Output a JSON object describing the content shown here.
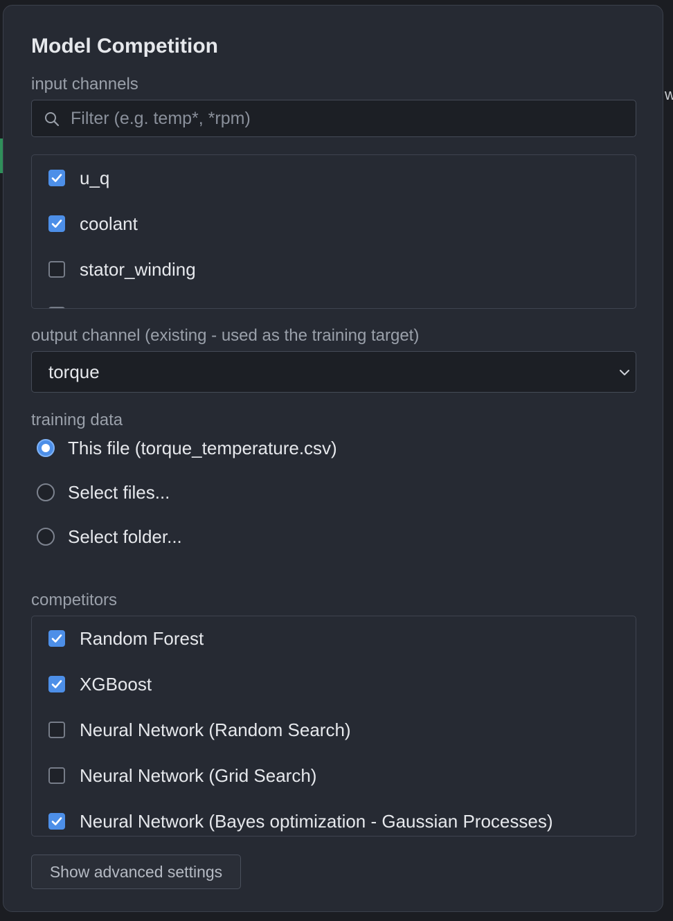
{
  "dialog": {
    "title": "Model Competition"
  },
  "input_channels": {
    "label": "input channels",
    "filter_placeholder": "Filter (e.g. temp*, *rpm)",
    "filter_value": "",
    "items": [
      {
        "label": "u_q",
        "checked": true
      },
      {
        "label": "coolant",
        "checked": true
      },
      {
        "label": "stator_winding",
        "checked": false
      },
      {
        "label": "",
        "checked": false
      }
    ]
  },
  "output_channel": {
    "label": "output channel (existing - used as the training target)",
    "selected": "torque"
  },
  "training_data": {
    "label": "training data",
    "options": [
      {
        "label": "This file (torque_temperature.csv)",
        "selected": true
      },
      {
        "label": "Select files...",
        "selected": false
      },
      {
        "label": "Select folder...",
        "selected": false
      }
    ]
  },
  "competitors": {
    "label": "competitors",
    "items": [
      {
        "label": "Random Forest",
        "checked": true
      },
      {
        "label": "XGBoost",
        "checked": true
      },
      {
        "label": "Neural Network (Random Search)",
        "checked": false
      },
      {
        "label": "Neural Network (Grid Search)",
        "checked": false
      },
      {
        "label": "Neural Network (Bayes optimization - Gaussian Processes)",
        "checked": true
      }
    ]
  },
  "advanced": {
    "button_label": "Show advanced settings"
  },
  "colors": {
    "accent": "#4d8fe8",
    "panel_bg": "#262a33",
    "input_bg": "#1c1f25"
  }
}
